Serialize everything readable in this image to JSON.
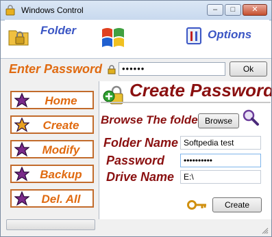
{
  "window": {
    "title": "Windows Control",
    "minimize": "–",
    "maximize": "□",
    "close": "✕"
  },
  "toolbar": {
    "folder_label": "Folder",
    "options_label": "Options"
  },
  "login": {
    "label": "Enter Password",
    "value": "••••••",
    "ok_label": "Ok"
  },
  "nav": {
    "items": [
      {
        "label": "Home"
      },
      {
        "label": "Create"
      },
      {
        "label": "Modify"
      },
      {
        "label": "Backup"
      },
      {
        "label": "Del. All"
      }
    ]
  },
  "create": {
    "title": "Create Password",
    "browse_label": "Browse The folder",
    "browse_button": "Browse",
    "folder_name_label": "Folder Name",
    "folder_name_value": "Softpedia test",
    "password_label": "Password",
    "password_value": "••••••••••",
    "drive_name_label": "Drive Name",
    "drive_name_value": "E:\\",
    "create_button": "Create"
  },
  "colors": {
    "accent_orange": "#e06a10",
    "title_red": "#8a1010",
    "link_blue": "#3a55c4"
  }
}
